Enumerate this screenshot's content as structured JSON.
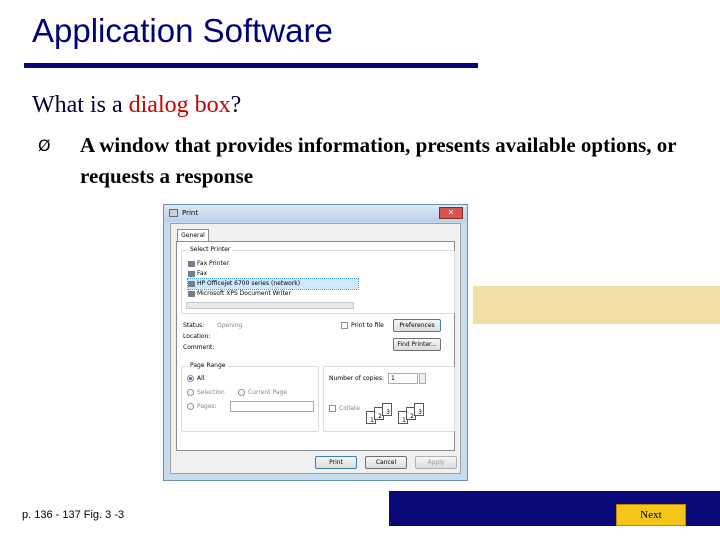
{
  "slide": {
    "title": "Application Software",
    "question_prefix": "What is a ",
    "question_highlight": "dialog box",
    "question_suffix": "?",
    "bullet_marker": "Ø",
    "bullet_text": "A window that provides information, presents available options, or requests a response",
    "caption": "p. 136 - 137 Fig. 3 -3",
    "next_label": "Next"
  },
  "dialog": {
    "title": "Print",
    "close_glyph": "✕",
    "tab_general": "General",
    "select_printer_label": "Select Printer",
    "printers": [
      "Fax Printer",
      "Fax",
      "HP Officejet 6700 series (network)",
      "Microsoft XPS Document Writer"
    ],
    "status_label": "Status:",
    "status_value": "Opening",
    "location_label": "Location:",
    "comment_label": "Comment:",
    "print_to_file_label": "Print to file",
    "preferences_button": "Preferences",
    "find_printer_button": "Find Printer...",
    "page_range_label": "Page Range",
    "range_all": "All",
    "range_selection": "Selection",
    "range_current_page": "Current Page",
    "range_pages": "Pages:",
    "copies_label": "Number of copies:",
    "copies_value": "1",
    "collate_label": "Collate",
    "print_button": "Print",
    "cancel_button": "Cancel",
    "apply_button": "Apply",
    "collate_pages": [
      "1",
      "2",
      "3",
      "1",
      "2",
      "3"
    ]
  },
  "colors": {
    "title": "#00007a",
    "highlight": "#cc0000",
    "gold_bar": "#f0dfa6",
    "blue_bar": "#0a0a7a",
    "next_button": "#f5c518"
  }
}
